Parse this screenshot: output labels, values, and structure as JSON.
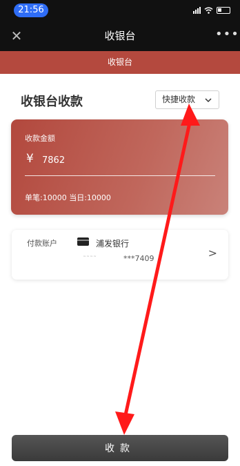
{
  "status_bar": {
    "time": "21:56"
  },
  "navbar": {
    "close_icon": "close-icon",
    "title": "收银台",
    "more_icon": "more-icon"
  },
  "subheader": {
    "title": "收银台"
  },
  "page": {
    "title": "收银台收款"
  },
  "mode_select": {
    "value": "快捷收款",
    "chevron_icon": "chevron-down-icon"
  },
  "amount_card": {
    "label": "收款金额",
    "currency_symbol": "¥",
    "amount": "7862",
    "limit": "单笔:10000 当日:10000"
  },
  "account": {
    "label": "付款账户",
    "bank_name": "浦发银行",
    "masked_number": "***7409",
    "card_icon": "card-icon",
    "chevron_icon": "chevron-right-icon"
  },
  "submit": {
    "label": "收款"
  },
  "annotations": {
    "arrow_color": "#ff1a1a"
  }
}
